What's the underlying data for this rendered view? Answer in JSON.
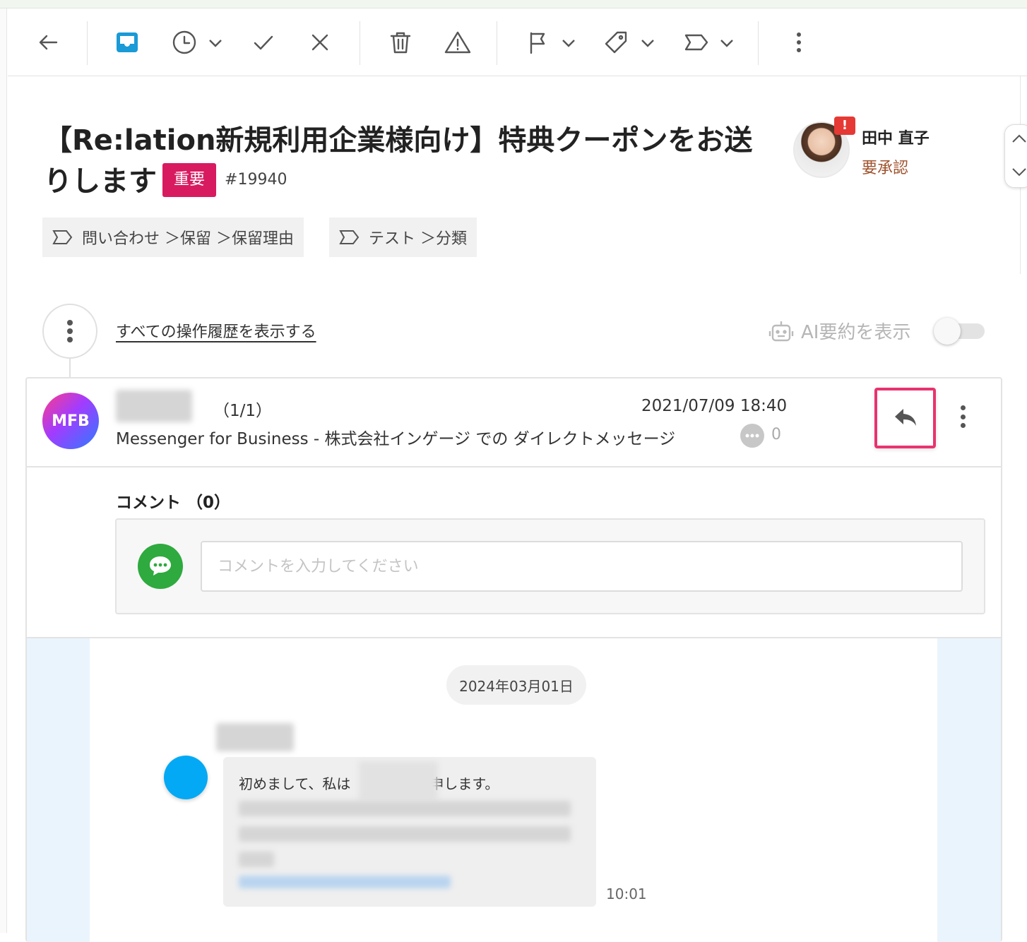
{
  "toolbar": {
    "icons": [
      "back-arrow-icon",
      "inbox-icon",
      "clock-icon",
      "check-icon",
      "close-icon",
      "trash-icon",
      "warning-icon",
      "flag-icon",
      "tag-icon",
      "label-icon",
      "more-vertical-icon"
    ]
  },
  "ticket": {
    "title": "【Re:lation新規利用企業様向け】特典クーポンをお送りします",
    "badge": "重要",
    "number": "#19940",
    "labels": [
      "問い合わせ ＞保留 ＞保留理由",
      "テスト ＞分類"
    ]
  },
  "assignee": {
    "name": "田中 直子",
    "status": "要承認",
    "alert": "!"
  },
  "history": {
    "link": "すべての操作履歴を表示する",
    "ai_summary": "AI要約を表示",
    "ai_enabled": false
  },
  "message": {
    "avatar_text": "MFB",
    "count": "（1/1）",
    "datetime": "2021/07/09 18:40",
    "source": "Messenger for Business  -  株式会社インゲージ での ダイレクトメッセージ",
    "comment_count": "0"
  },
  "comments": {
    "heading": "コメント （0）",
    "placeholder": "コメントを入力してください"
  },
  "chat": {
    "date": "2024年03月01日",
    "text_start": "初めまして、私は",
    "text_end": "申します。",
    "time": "10:01"
  },
  "colors": {
    "accent": "#1a9ad6",
    "important": "#d81b60",
    "highlight": "#e8336e",
    "alert": "#e53935",
    "comment_avatar": "#2eaa3e"
  }
}
